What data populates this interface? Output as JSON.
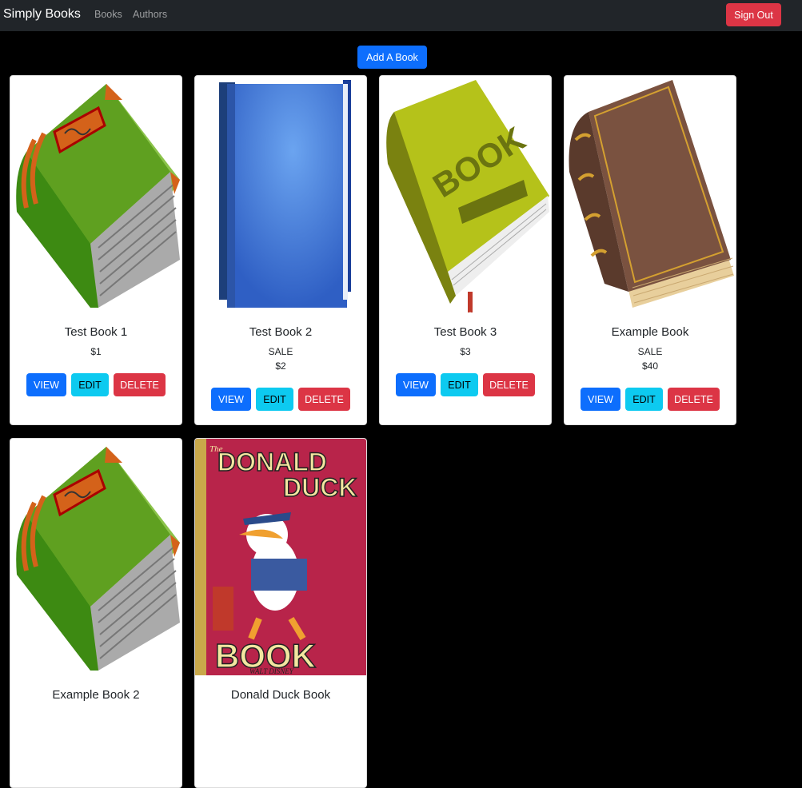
{
  "nav": {
    "brand": "Simply Books",
    "links": [
      "Books",
      "Authors"
    ],
    "signout": "Sign Out"
  },
  "add_book": "Add A Book",
  "buttons": {
    "view": "VIEW",
    "edit": "EDIT",
    "delete": "DELETE"
  },
  "books": [
    {
      "title": "Test Book 1",
      "sale": "",
      "price": "$1",
      "cover_icon": "green-book-icon"
    },
    {
      "title": "Test Book 2",
      "sale": "SALE",
      "price": "$2",
      "cover_icon": "blue-book-icon"
    },
    {
      "title": "Test Book 3",
      "sale": "",
      "price": "$3",
      "cover_icon": "olive-book-icon"
    },
    {
      "title": "Example Book",
      "sale": "SALE",
      "price": "$40",
      "cover_icon": "brown-book-icon"
    },
    {
      "title": "Example Book 2",
      "sale": "",
      "price": "",
      "cover_icon": "green-book-icon"
    },
    {
      "title": "Donald Duck Book",
      "sale": "",
      "price": "",
      "cover_icon": "donald-duck-cover-icon"
    }
  ],
  "cover_art": {
    "donald_line1": "DONALD",
    "donald_line2": "DUCK",
    "donald_line3": "BOOK",
    "donald_small": "The",
    "donald_sig": "WALT DISNEY",
    "olive_label": "BOOK"
  }
}
